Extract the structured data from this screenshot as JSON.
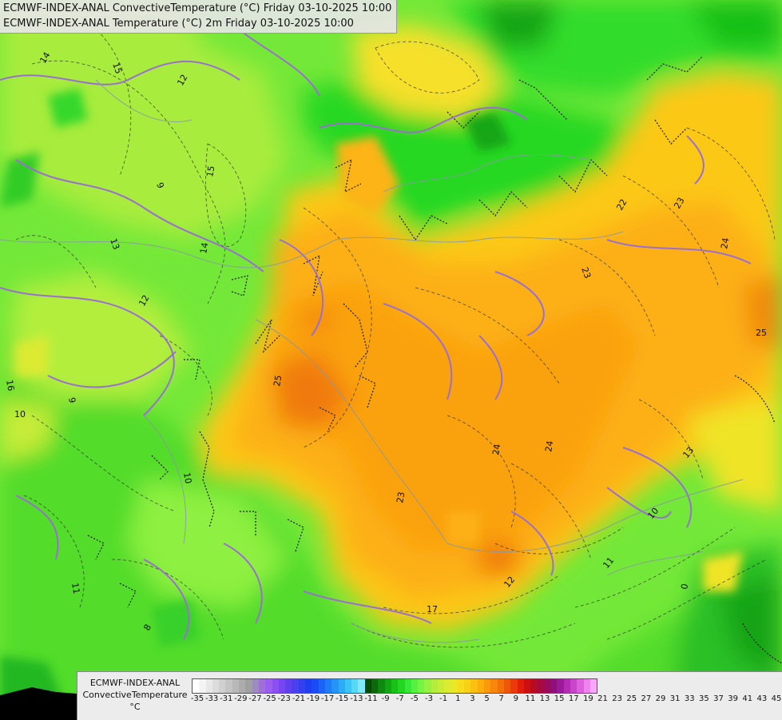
{
  "header": {
    "line1": "ECMWF-INDEX-ANAL ConvectiveTemperature (°C) Friday 03-10-2025 10:00",
    "line2": "ECMWF-INDEX-ANAL Temperature (°C) 2m Friday 03-10-2025 10:00"
  },
  "legend": {
    "title_line1": "ECMWF-INDEX-ANAL",
    "title_line2": "ConvectiveTemperature",
    "unit": "°C",
    "tick_labels": [
      "-35",
      "-33",
      "-31",
      "-29",
      "-27",
      "-25",
      "-23",
      "-21",
      "-19",
      "-17",
      "-15",
      "-13",
      "-11",
      "-9",
      "-7",
      "-5",
      "-3",
      "-1",
      "1",
      "3",
      "5",
      "7",
      "9",
      "11",
      "13",
      "15",
      "17",
      "19",
      "21",
      "23",
      "25",
      "27",
      "29",
      "31",
      "33",
      "35",
      "37",
      "39",
      "41",
      "43",
      "45"
    ],
    "colors": [
      "#ffffff",
      "#f4f4f4",
      "#e8e8e8",
      "#dcdcdc",
      "#d0d0d0",
      "#c4c4c4",
      "#b8b8b8",
      "#acacac",
      "#a0a0a0",
      "#9c8cc0",
      "#a070d8",
      "#9a5ef0",
      "#8a50f4",
      "#7646f0",
      "#6040ee",
      "#4a40ee",
      "#3440ee",
      "#1f3ef0",
      "#1a4cf6",
      "#1c64f6",
      "#1e7cf6",
      "#2494f6",
      "#2cacf6",
      "#3cc4f6",
      "#58d8f6",
      "#80e8f6",
      "#064a06",
      "#0a6a0a",
      "#0e880e",
      "#12a612",
      "#18c018",
      "#22d622",
      "#38e838",
      "#58f040",
      "#78f440",
      "#98f040",
      "#b4ee3c",
      "#c8ec38",
      "#dcea30",
      "#ece624",
      "#f6dc1c",
      "#fad014",
      "#fcc010",
      "#fcae0c",
      "#fa9a0a",
      "#f8860a",
      "#f4700a",
      "#f0560a",
      "#ea3a0a",
      "#e01e0a",
      "#cc1010",
      "#b80c20",
      "#a60a40",
      "#980c5e",
      "#8e107c",
      "#9a1a9a",
      "#b42cb4",
      "#c844c8",
      "#dc62dc",
      "#ee84ee",
      "#f8a8f8"
    ]
  },
  "map_labels": [
    "14",
    "15",
    "12",
    "9",
    "15",
    "13",
    "14",
    "12",
    "16",
    "10",
    "9",
    "10",
    "11",
    "8",
    "25",
    "23",
    "22",
    "23",
    "24",
    "25",
    "24",
    "24",
    "23",
    "17",
    "10",
    "11",
    "0",
    "13",
    "12"
  ]
}
